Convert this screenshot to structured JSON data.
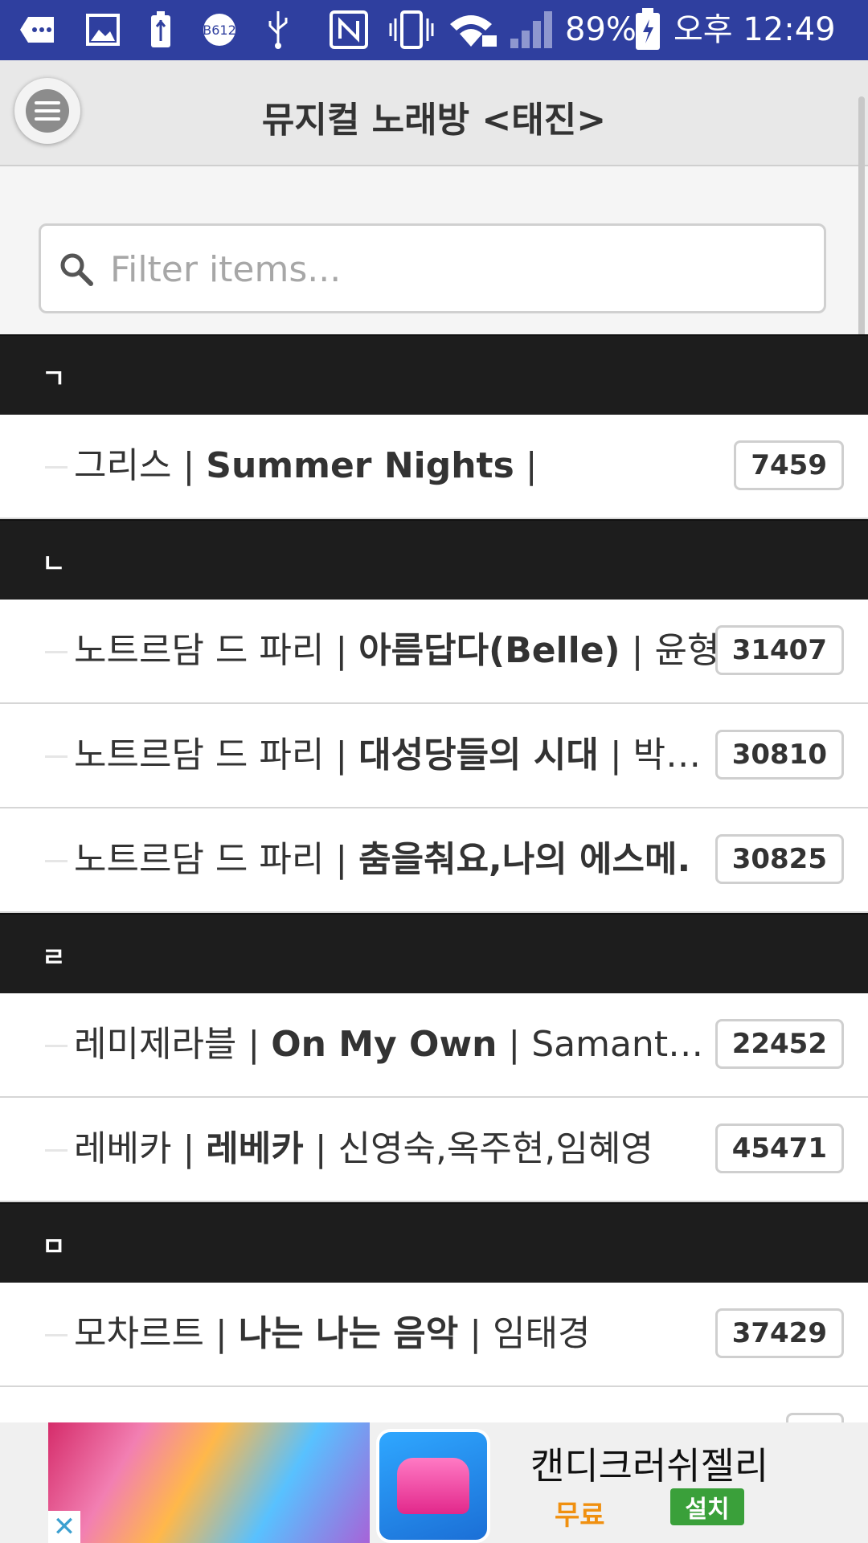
{
  "status_bar": {
    "battery_percent": "89%",
    "time": "오후 12:49",
    "icons": [
      "notification-icon",
      "gallery-icon",
      "usb-battery-icon",
      "b612-icon",
      "usb-icon",
      "nfc-icon",
      "vibrate-icon",
      "wifi-lock-icon",
      "signal-icon",
      "battery-icon"
    ]
  },
  "header": {
    "title": "뮤지컬 노래방 <태진>",
    "menu_icon": "menu-icon"
  },
  "search": {
    "placeholder": "Filter items..."
  },
  "sections": [
    {
      "header": "ㄱ",
      "items": [
        {
          "show": "그리스",
          "song": "Summer Nights",
          "artist": "",
          "code": "7459"
        }
      ]
    },
    {
      "header": "ㄴ",
      "items": [
        {
          "show": "노트르담 드 파리",
          "song": "아름답다(Belle)",
          "artist": "윤형",
          "code": "31407"
        },
        {
          "show": "노트르담 드 파리",
          "song": "대성당들의 시대",
          "artist": "박…",
          "code": "30810"
        },
        {
          "show": "노트르담 드 파리",
          "song": "춤을춰요,나의 에스메.",
          "artist": "",
          "code": "30825"
        }
      ]
    },
    {
      "header": "ㄹ",
      "items": [
        {
          "show": "레미제라블",
          "song": "On My Own",
          "artist": "Samantha B.",
          "code": "22452"
        },
        {
          "show": "레베카",
          "song": "레베카",
          "artist": "신영숙,옥주현,임혜영",
          "code": "45471"
        }
      ]
    },
    {
      "header": "ㅁ",
      "items": [
        {
          "show": "모차르트",
          "song": "나는 나는 음악",
          "artist": "임태경",
          "code": "37429"
        }
      ]
    }
  ],
  "ad": {
    "title": "캔디크러쉬젤리",
    "price": "무료",
    "install_label": "설치",
    "close_label": "✕"
  },
  "colors": {
    "status_bar": "#2f3f9f",
    "section_header": "#1d1d1d",
    "install_button": "#3aa03a",
    "price_text": "#f09010"
  }
}
